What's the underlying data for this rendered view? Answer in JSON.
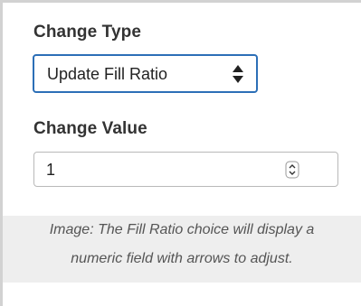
{
  "form": {
    "change_type_label": "Change Type",
    "change_type_selected": "Update Fill Ratio",
    "change_value_label": "Change Value",
    "change_value": "1"
  },
  "caption": {
    "line1": "Image: The Fill Ratio choice will display a",
    "line2": "numeric field with arrows to adjust."
  },
  "icons": {
    "select_arrows": "updown-arrows-icon",
    "spinner": "spinner-icon"
  },
  "colors": {
    "select_border": "#2c6fb7",
    "caption_bg": "#eeeeee",
    "label_text": "#333333"
  }
}
